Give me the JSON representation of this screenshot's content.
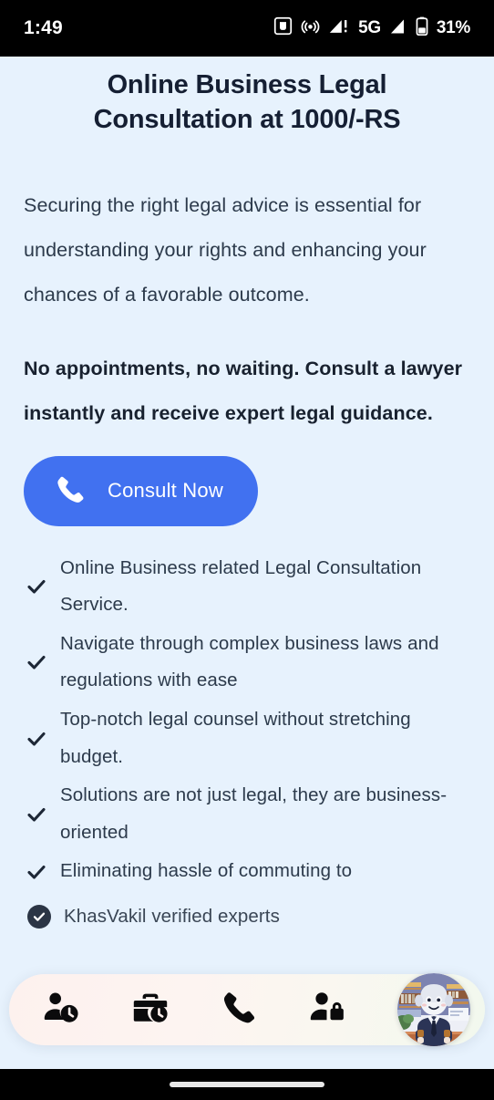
{
  "statusbar": {
    "time": "1:49",
    "network_label": "5G",
    "battery_label": "31%",
    "icons": [
      "screen-record-icon",
      "hotspot-icon",
      "signal-alert-icon",
      "signal-icon",
      "battery-icon"
    ]
  },
  "page": {
    "background_color": "#E7F2FD",
    "title": "Online Business Legal Consultation at 1000/-RS",
    "intro_paragraph": "Securing the right legal advice is essential for understanding your rights and enhancing your chances of a favorable outcome.",
    "highlight_paragraph": "No appointments, no waiting. Consult a lawyer instantly and receive expert legal guidance.",
    "cta": {
      "label": "Consult Now",
      "icon": "phone-icon",
      "background_color": "#4171F0",
      "text_color": "#FFFFFF"
    },
    "checklist": [
      "Online Business related Legal Consultation Service.",
      "Navigate through complex business laws and regulations with ease",
      "Top-notch legal counsel without stretching budget.",
      "Solutions are not just legal, they are business-oriented",
      "Eliminating hassle of commuting to"
    ],
    "verified": {
      "icon": "verified-check-icon",
      "text": "KhasVakil verified experts"
    }
  },
  "navbar": {
    "background_color": "#FDF1EE",
    "items": [
      {
        "name": "nav-item-history",
        "icon": "person-clock-icon"
      },
      {
        "name": "nav-item-cases",
        "icon": "briefcase-clock-icon"
      },
      {
        "name": "nav-item-call",
        "icon": "phone-icon"
      },
      {
        "name": "nav-item-privacy",
        "icon": "person-lock-icon"
      },
      {
        "name": "nav-item-profile",
        "icon": "lawyer-avatar"
      }
    ]
  }
}
